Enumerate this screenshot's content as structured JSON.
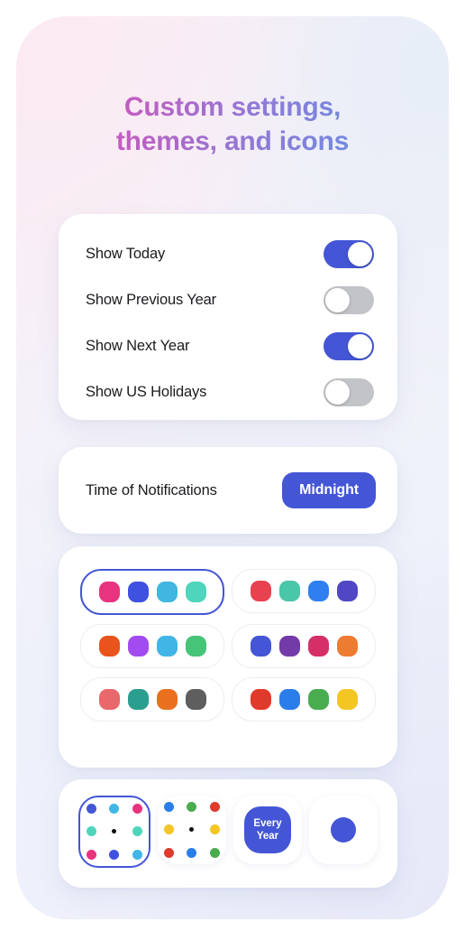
{
  "heading": {
    "line1": "Custom settings,",
    "line2": "themes, and icons"
  },
  "colors": {
    "accent": "#4456d6",
    "toggle_on": "#4456d6",
    "toggle_off": "#c3c4c8",
    "heading_gradient_start": "#d956a8",
    "heading_gradient_end": "#6e8fe2",
    "card_background": "#ffffff"
  },
  "settings": {
    "rows": [
      {
        "label": "Show Today",
        "state": "on"
      },
      {
        "label": "Show Previous Year",
        "state": "off"
      },
      {
        "label": "Show Next Year",
        "state": "on"
      },
      {
        "label": "Show US Holidays",
        "state": "off"
      }
    ]
  },
  "notifications": {
    "label": "Time of Notifications",
    "value": "Midnight"
  },
  "themes": {
    "selected_index": 0,
    "swatches": [
      {
        "colors": [
          "#e8337f",
          "#3f51e0",
          "#41b6e0",
          "#4ed5bb"
        ],
        "selected": true
      },
      {
        "colors": [
          "#e8414f",
          "#4ac6a8",
          "#2f7ff0",
          "#5146c4"
        ],
        "selected": false
      },
      {
        "colors": [
          "#e8541c",
          "#a24bf0",
          "#41b6e6",
          "#46c478"
        ],
        "selected": false
      },
      {
        "colors": [
          "#4456d6",
          "#733ba8",
          "#d62e66",
          "#ed7b30"
        ],
        "selected": false
      },
      {
        "colors": [
          "#e8686b",
          "#2a9e8f",
          "#ea7020",
          "#5e5e5e"
        ],
        "selected": false
      },
      {
        "colors": [
          "#e03a2b",
          "#2b7de9",
          "#49ad50",
          "#f3c623"
        ],
        "selected": false
      }
    ]
  },
  "app_icons": {
    "selected_index": 0,
    "items": [
      {
        "name": "dots-pastel-icon",
        "type": "dots",
        "selected": true,
        "dots": [
          "#4456d6",
          "#41b6e6",
          "#e8337f",
          "#4ed5bb",
          "center",
          "#4ed5bb",
          "#e8337f",
          "#3f51e0",
          "#41b6e6"
        ]
      },
      {
        "name": "dots-google-icon",
        "type": "dots",
        "selected": false,
        "dots": [
          "#2b7de9",
          "#49ad50",
          "#e03a2b",
          "#f3c623",
          "center",
          "#f3c623",
          "#e03a2b",
          "#2b7de9",
          "#49ad50"
        ]
      },
      {
        "name": "every-year-badge-icon",
        "type": "badge",
        "selected": false,
        "line1": "Every",
        "line2": "Year"
      },
      {
        "name": "single-dot-icon",
        "type": "single-dot",
        "selected": false
      }
    ]
  }
}
